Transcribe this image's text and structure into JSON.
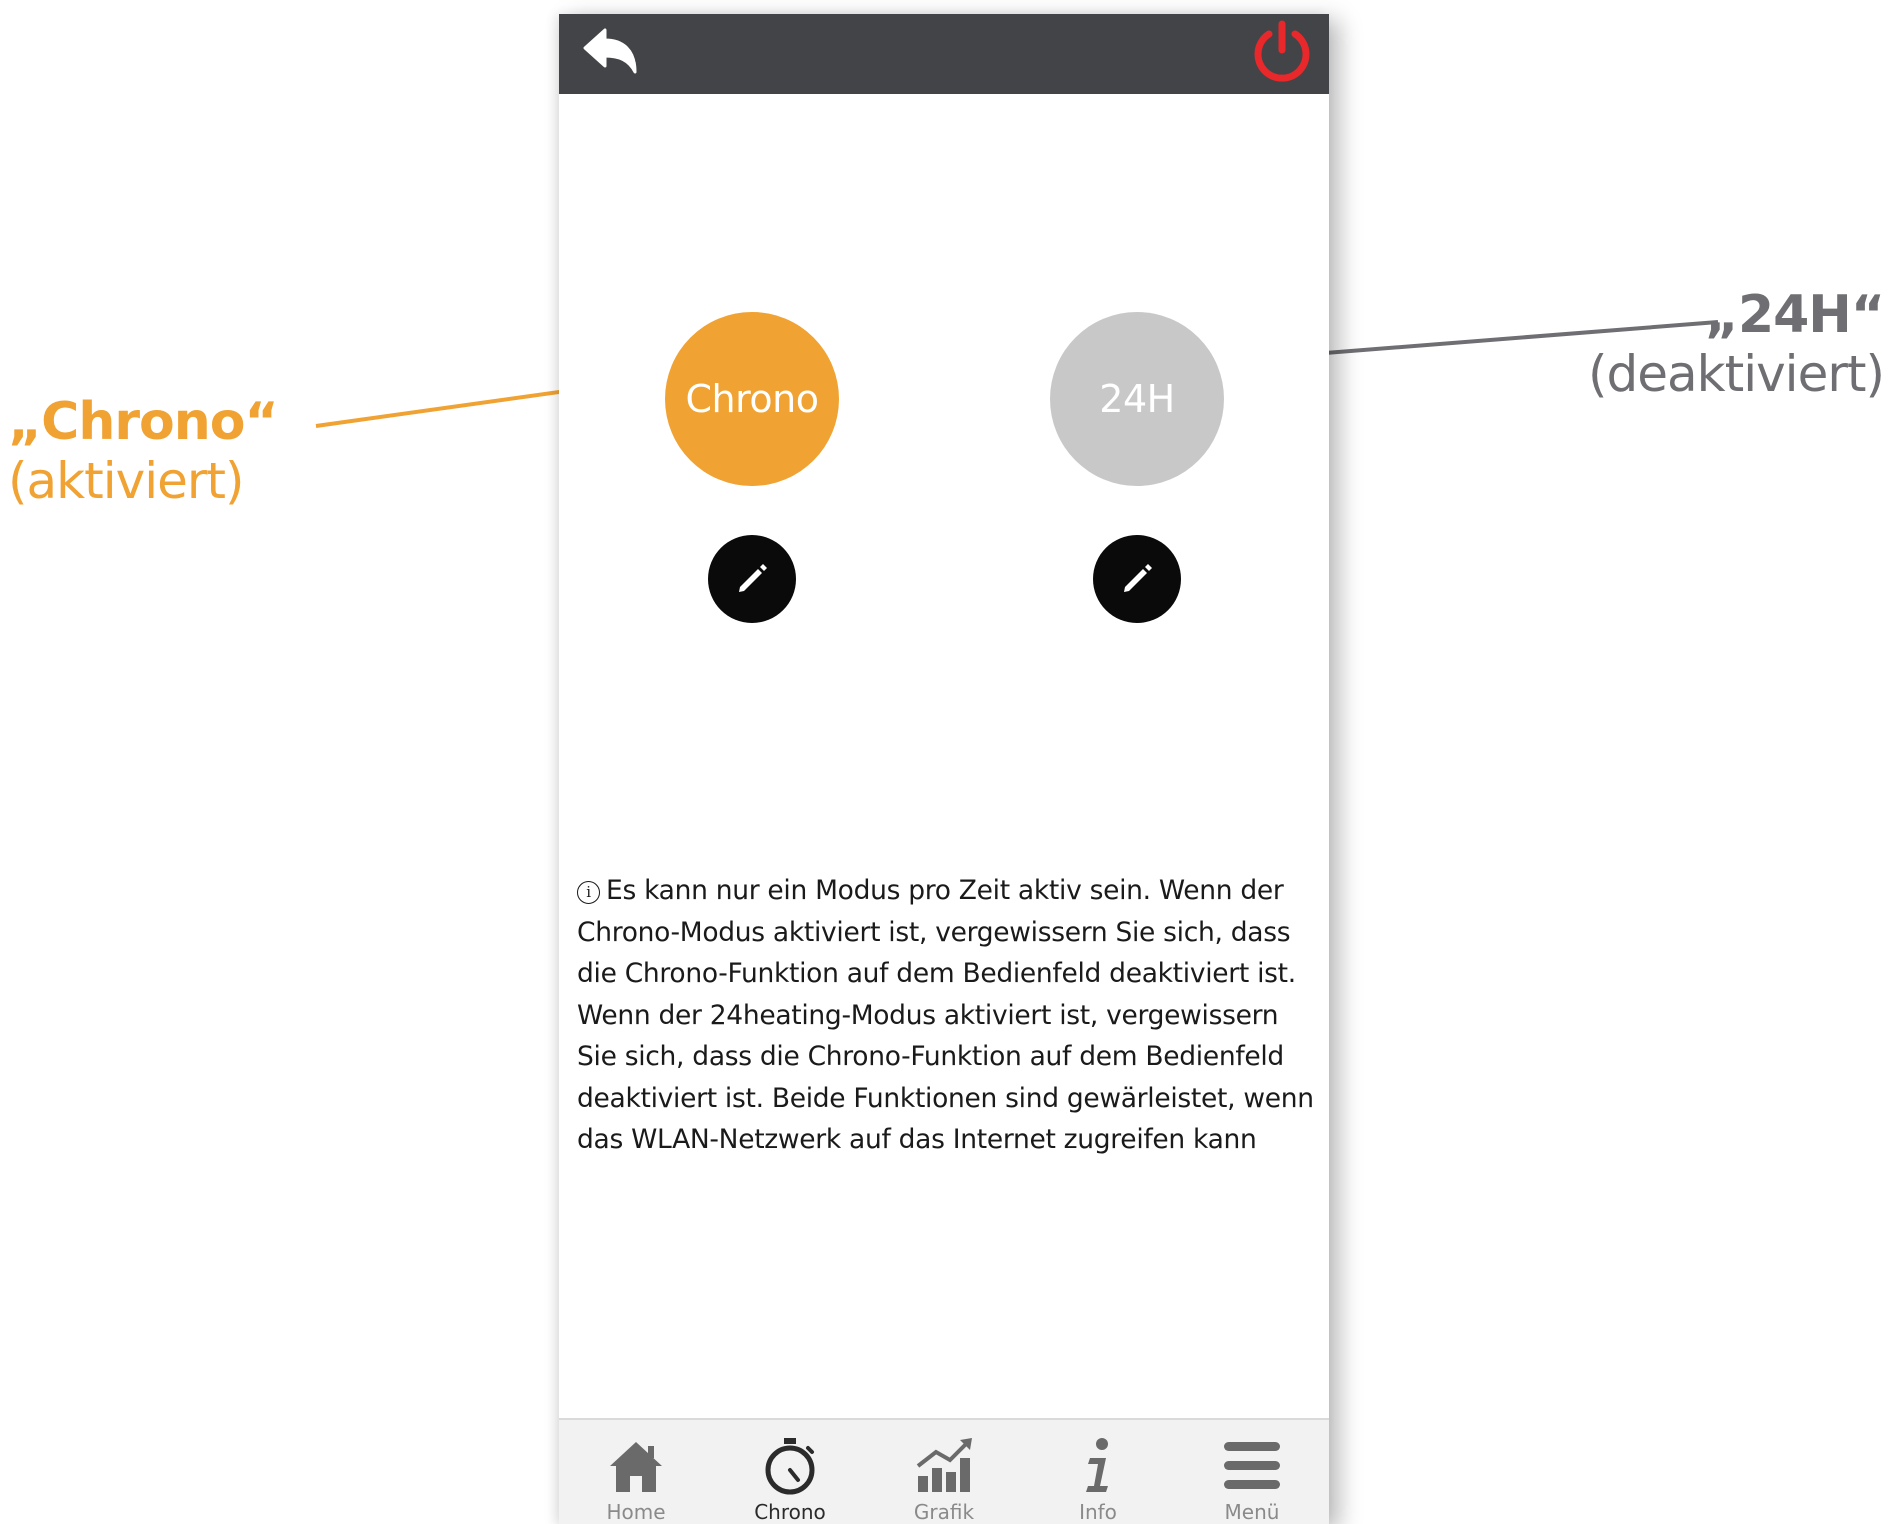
{
  "top_bar": {
    "back_icon": "back-arrow-icon",
    "power_icon": "power-icon",
    "power_color": "#e8282b",
    "bar_color": "#434447"
  },
  "modes": {
    "chrono": {
      "label": "Chrono",
      "color": "#f0a232",
      "state": "active"
    },
    "h24": {
      "label": "24H",
      "color": "#c8c8c9",
      "state": "inactive"
    }
  },
  "edit_icon": "pencil-icon",
  "info": {
    "icon": "info-circle-icon",
    "text": "Es kann nur ein Modus pro Zeit aktiv sein. Wenn der Chrono-Modus aktiviert ist, vergewissern Sie sich, dass die Chrono-Funktion auf dem Bedienfeld deaktiviert ist. Wenn der 24heating-Modus aktiviert ist, vergewissern Sie sich, dass die Chrono-Funktion auf dem Bedienfeld deaktiviert ist. Beide Funktionen sind gewärleistet, wenn das WLAN-Netzwerk auf das Internet zugreifen kann"
  },
  "bottom_nav": {
    "items": [
      {
        "label": "Home",
        "icon": "home-icon",
        "active": false
      },
      {
        "label": "Chrono",
        "icon": "stopwatch-icon",
        "active": true
      },
      {
        "label": "Grafik",
        "icon": "chart-icon",
        "active": false
      },
      {
        "label": "Info",
        "icon": "info-icon",
        "active": false
      },
      {
        "label": "Menü",
        "icon": "menu-icon",
        "active": false
      }
    ]
  },
  "callouts": {
    "chrono": {
      "title": "„Chrono“",
      "subtitle": "(aktiviert)",
      "color": "#f0a232"
    },
    "h24": {
      "title": "„24H“",
      "subtitle": "(deaktiviert)",
      "color": "#6f6f73"
    }
  }
}
